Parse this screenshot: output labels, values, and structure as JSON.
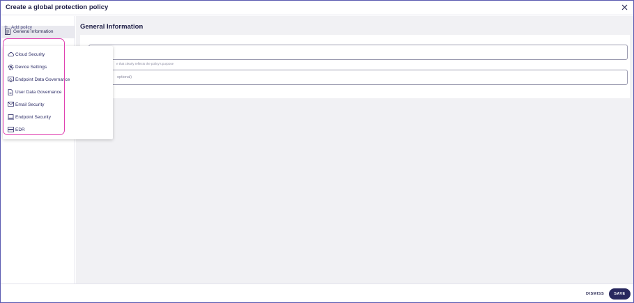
{
  "dialog": {
    "title": "Create a global protection policy",
    "close_icon": "close-icon"
  },
  "sidebar": {
    "general_information": {
      "label": "General Information",
      "icon": "form-icon"
    },
    "add_policy": {
      "label": "Add policy",
      "icon": "plus-icon"
    }
  },
  "main": {
    "section_title": "General Information",
    "name_field": {
      "value": "",
      "helper_partial": "e that clearly reflects the policy's purpose"
    },
    "description_field": {
      "placeholder_partial": "optional)"
    }
  },
  "policy_menu": {
    "items": [
      {
        "label": "Cloud Security",
        "icon": "cloud-icon"
      },
      {
        "label": "Device Settings",
        "icon": "gear-icon"
      },
      {
        "label": "Endpoint Data Governance",
        "icon": "monitor-icon"
      },
      {
        "label": "User Data Governance",
        "icon": "document-icon"
      },
      {
        "label": "Email Security",
        "icon": "envelope-icon"
      },
      {
        "label": "Endpoint Security",
        "icon": "laptop-icon"
      },
      {
        "label": "EDR",
        "icon": "server-icon"
      }
    ],
    "highlight_color": "#e040b0"
  },
  "footer": {
    "dismiss_label": "DISMISS",
    "save_label": "SAVE"
  },
  "colors": {
    "accent": "#28285e",
    "text": "#2e2e68",
    "main_bg": "#f1f1f4"
  }
}
